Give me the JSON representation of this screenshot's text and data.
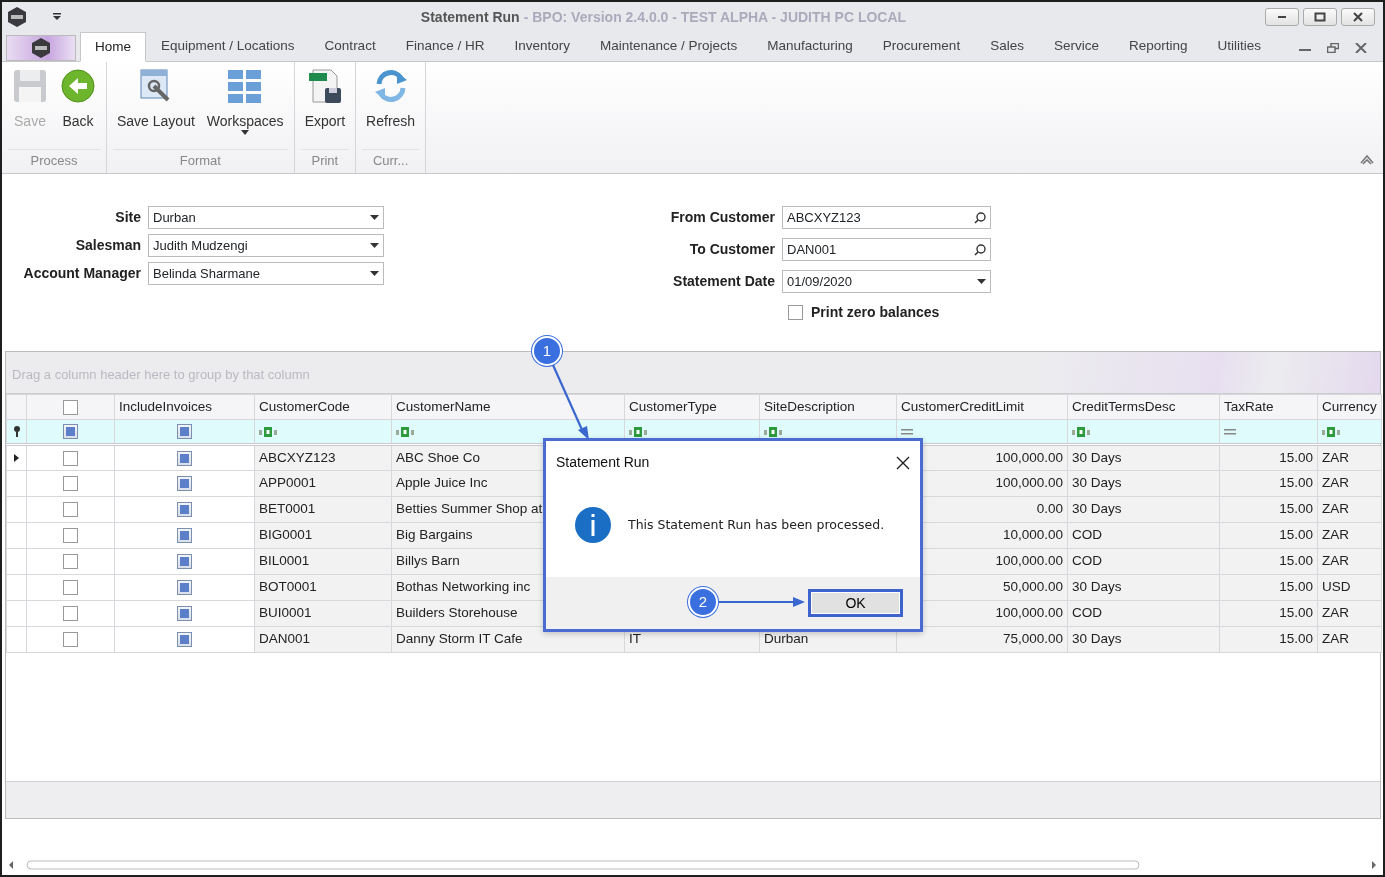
{
  "window": {
    "title": "Statement Run",
    "subtitle": "- BPO: Version 2.4.0.0 - TEST ALPHA - JUDITH PC LOCAL"
  },
  "menu_tabs": [
    {
      "label": "Home",
      "selected": true
    },
    {
      "label": "Equipment / Locations",
      "selected": false
    },
    {
      "label": "Contract",
      "selected": false
    },
    {
      "label": "Finance / HR",
      "selected": false
    },
    {
      "label": "Inventory",
      "selected": false
    },
    {
      "label": "Maintenance / Projects",
      "selected": false
    },
    {
      "label": "Manufacturing",
      "selected": false
    },
    {
      "label": "Procurement",
      "selected": false
    },
    {
      "label": "Sales",
      "selected": false
    },
    {
      "label": "Service",
      "selected": false
    },
    {
      "label": "Reporting",
      "selected": false
    },
    {
      "label": "Utilities",
      "selected": false
    }
  ],
  "ribbon_groups": [
    {
      "label": "Process",
      "buttons": [
        {
          "label": "Save",
          "kind": "save",
          "disabled": true
        },
        {
          "label": "Back",
          "kind": "back",
          "disabled": false
        }
      ]
    },
    {
      "label": "Format",
      "buttons": [
        {
          "label": "Save Layout",
          "kind": "layout",
          "disabled": false
        },
        {
          "label": "Workspaces",
          "kind": "workspaces",
          "disabled": false
        }
      ]
    },
    {
      "label": "Print",
      "buttons": [
        {
          "label": "Export",
          "kind": "export",
          "disabled": false
        }
      ]
    },
    {
      "label": "Curr...",
      "buttons": [
        {
          "label": "Refresh",
          "kind": "refresh",
          "disabled": false
        }
      ]
    }
  ],
  "filters_left": [
    {
      "label": "Site",
      "value": "Durban",
      "kind": "dropdown"
    },
    {
      "label": "Salesman",
      "value": "Judith Mudzengi",
      "kind": "dropdown"
    },
    {
      "label": "Account Manager",
      "value": "Belinda Sharmane",
      "kind": "dropdown"
    }
  ],
  "filters_right": [
    {
      "label": "From Customer",
      "value": "ABCXYZ123",
      "kind": "search"
    },
    {
      "label": "To Customer",
      "value": "DAN001",
      "kind": "search"
    },
    {
      "label": "Statement Date",
      "value": "01/09/2020",
      "kind": "dropdown"
    }
  ],
  "print_zero_balances": {
    "label": "Print zero balances",
    "checked": false
  },
  "grid": {
    "group_hint": "Drag a column header here to group by that column",
    "header_checked": false,
    "columns": [
      {
        "label": "IncludeInvoices",
        "kind": "check"
      },
      {
        "label": "CustomerCode",
        "kind": "text"
      },
      {
        "label": "CustomerName",
        "kind": "text"
      },
      {
        "label": "CustomerType",
        "kind": "text"
      },
      {
        "label": "SiteDescription",
        "kind": "text"
      },
      {
        "label": "CustomerCreditLimit",
        "kind": "number"
      },
      {
        "label": "CreditTermsDesc",
        "kind": "text"
      },
      {
        "label": "TaxRate",
        "kind": "number"
      },
      {
        "label": "Currency",
        "kind": "text"
      }
    ],
    "rows": [
      {
        "selected": true,
        "checked": false,
        "include_invoices": true,
        "code": "ABCXYZ123",
        "name": "ABC Shoe Co",
        "credit_limit": "100,000.00",
        "terms": "30 Days",
        "tax_rate": "15.00",
        "currency": "ZAR"
      },
      {
        "selected": false,
        "checked": false,
        "include_invoices": true,
        "code": "APP0001",
        "name": "Apple Juice Inc",
        "credit_limit": "100,000.00",
        "terms": "30 Days",
        "tax_rate": "15.00",
        "currency": "ZAR"
      },
      {
        "selected": false,
        "checked": false,
        "include_invoices": true,
        "code": "BET0001",
        "name": "Betties Summer Shop at",
        "credit_limit": "0.00",
        "terms": "30 Days",
        "tax_rate": "15.00",
        "currency": "ZAR"
      },
      {
        "selected": false,
        "checked": false,
        "include_invoices": true,
        "code": "BIG0001",
        "name": "Big Bargains",
        "credit_limit": "10,000.00",
        "terms": "COD",
        "tax_rate": "15.00",
        "currency": "ZAR"
      },
      {
        "selected": false,
        "checked": false,
        "include_invoices": true,
        "code": "BIL0001",
        "name": "Billys Barn",
        "credit_limit": "100,000.00",
        "terms": "COD",
        "tax_rate": "15.00",
        "currency": "ZAR"
      },
      {
        "selected": false,
        "checked": false,
        "include_invoices": true,
        "code": "BOT0001",
        "name": "Bothas Networking inc",
        "credit_limit": "50,000.00",
        "terms": "30 Days",
        "tax_rate": "15.00",
        "currency": "USD"
      },
      {
        "selected": false,
        "checked": false,
        "include_invoices": true,
        "code": "BUI0001",
        "name": "Builders Storehouse",
        "credit_limit": "100,000.00",
        "terms": "COD",
        "tax_rate": "15.00",
        "currency": "ZAR"
      },
      {
        "selected": false,
        "checked": false,
        "include_invoices": true,
        "code": "DAN001",
        "name": "Danny Storm IT Cafe",
        "type": "IT",
        "site": "Durban",
        "credit_limit": "75,000.00",
        "terms": "30 Days",
        "tax_rate": "15.00",
        "currency": "ZAR"
      }
    ]
  },
  "dialog": {
    "title": "Statement Run",
    "message": "This Statement Run has been processed.",
    "button": "OK"
  },
  "annotations": [
    {
      "number": "1"
    },
    {
      "number": "2"
    }
  ]
}
